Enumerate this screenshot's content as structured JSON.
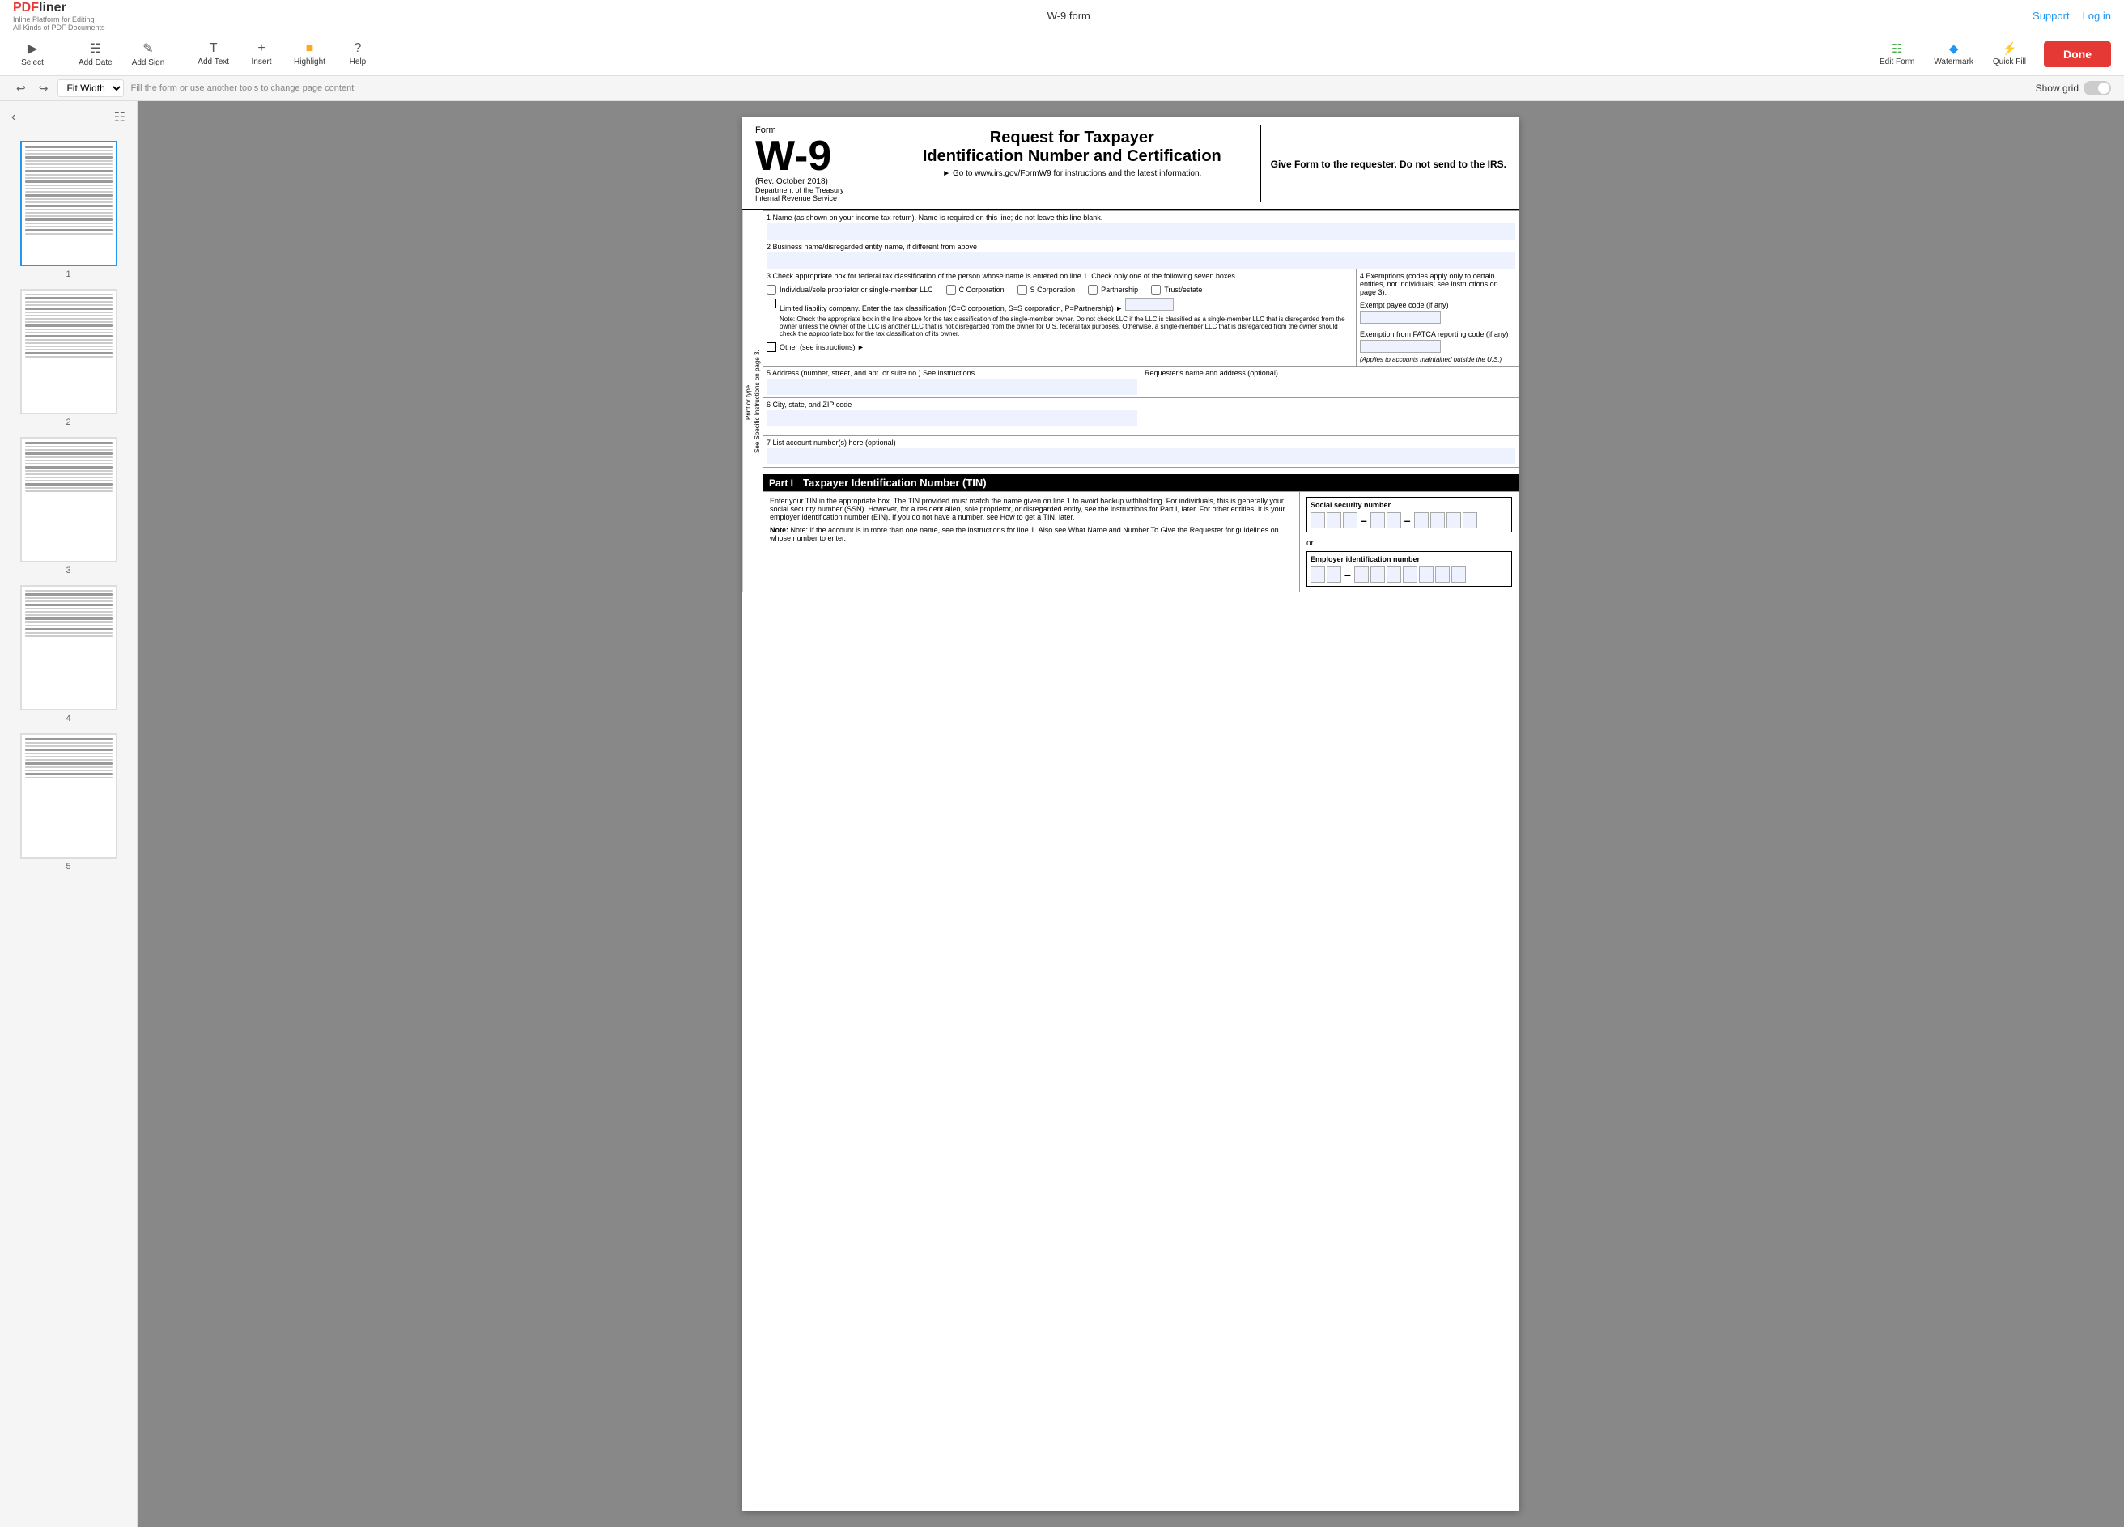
{
  "app": {
    "logo_pdf": "PDF",
    "logo_liner": "liner",
    "logo_tagline_1": "Inline Platform for Editing",
    "logo_tagline_2": "All Kinds of PDF Documents",
    "title": "W-9 form",
    "support": "Support",
    "login": "Log in"
  },
  "toolbar": {
    "select": "Select",
    "add_date": "Add Date",
    "add_sign": "Add Sign",
    "add_text": "Add Text",
    "insert": "Insert",
    "highlight": "Highlight",
    "help": "Help",
    "edit_form": "Edit Form",
    "watermark": "Watermark",
    "quick_fill": "Quick Fill",
    "done": "Done"
  },
  "subtoolbar": {
    "fit_option": "Fit Width",
    "hint": "Fill the form or use another tools to change page content",
    "show_grid": "Show grid"
  },
  "pages": [
    {
      "id": 1,
      "label": "1"
    },
    {
      "id": 2,
      "label": "2"
    },
    {
      "id": 3,
      "label": "3"
    },
    {
      "id": 4,
      "label": "4"
    },
    {
      "id": 5,
      "label": "5"
    }
  ],
  "form": {
    "form_label": "Form",
    "form_number": "W-9",
    "rev_date": "(Rev. October 2018)",
    "department": "Department of the Treasury",
    "irs": "Internal Revenue Service",
    "title_line1": "Request for Taxpayer",
    "title_line2": "Identification Number and Certification",
    "go_to": "► Go to www.irs.gov/FormW9 for instructions and the latest information.",
    "give_form": "Give Form to the requester. Do not send to the IRS.",
    "field1_label": "1  Name (as shown on your income tax return). Name is required on this line; do not leave this line blank.",
    "field2_label": "2  Business name/disregarded entity name, if different from above",
    "field3_label": "3  Check appropriate box for federal tax classification of the person whose name is entered on line 1. Check only one of the following seven boxes.",
    "field4_label": "4  Exemptions (codes apply only to certain entities, not individuals; see instructions on page 3):",
    "checkbox_individual": "Individual/sole proprietor or single-member LLC",
    "checkbox_ccorp": "C Corporation",
    "checkbox_scorp": "S Corporation",
    "checkbox_partnership": "Partnership",
    "checkbox_trust": "Trust/estate",
    "llc_label": "Limited liability company. Enter the tax classification (C=C corporation, S=S corporation, P=Partnership) ►",
    "llc_note": "Note: Check the appropriate box in the line above for the tax classification of the single-member owner. Do not check LLC if the LLC is classified as a single-member LLC that is disregarded from the owner unless the owner of the LLC is another LLC that is not disregarded from the owner for U.S. federal tax purposes. Otherwise, a single-member LLC that is disregarded from the owner should check the appropriate box for the tax classification of its owner.",
    "other_label": "Other (see instructions) ►",
    "exempt_payee_label": "Exempt payee code (if any)",
    "fatca_label": "Exemption from FATCA reporting code (if any)",
    "fatca_note": "(Applies to accounts maintained outside the U.S.)",
    "field5_label": "5  Address (number, street, and apt. or suite no.) See instructions.",
    "field5b_label": "Requester's name and address (optional)",
    "field6_label": "6  City, state, and ZIP code",
    "field7_label": "7  List account number(s) here (optional)",
    "part1_label": "Part I",
    "part1_title": "Taxpayer Identification Number (TIN)",
    "part1_text": "Enter your TIN in the appropriate box. The TIN provided must match the name given on line 1 to avoid backup withholding. For individuals, this is generally your social security number (SSN). However, for a resident alien, sole proprietor, or disregarded entity, see the instructions for Part I, later. For other entities, it is your employer identification number (EIN). If you do not have a number, see How to get a TIN, later.",
    "part1_note": "Note: If the account is in more than one name, see the instructions for line 1. Also see What Name and Number To Give the Requester for guidelines on whose number to enter.",
    "ssn_label": "Social security number",
    "or_text": "or",
    "ein_label": "Employer identification number",
    "print_or_type": "Print or type.",
    "specific_instructions": "See Specific Instructions on page 3."
  }
}
